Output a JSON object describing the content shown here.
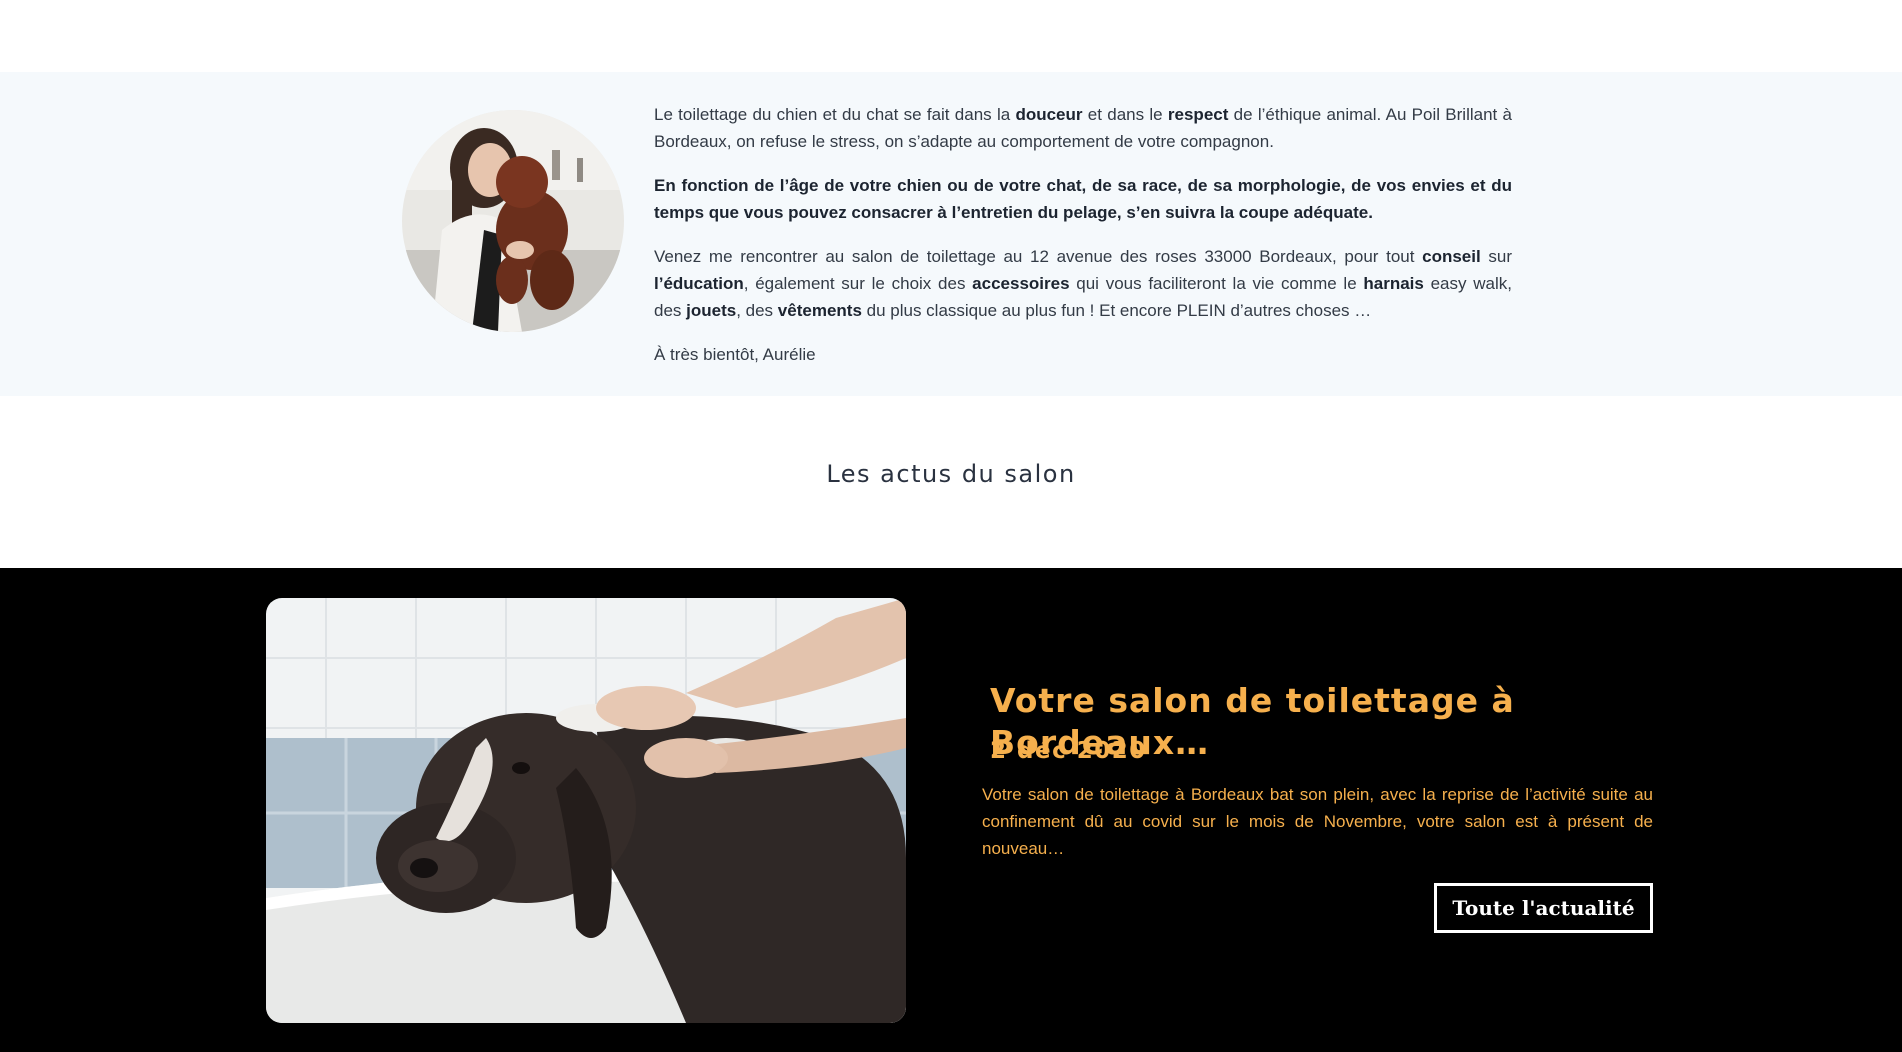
{
  "intro": {
    "avatar_alt": "Aurélie portrait with dog",
    "p1": {
      "t1": "Le toilettage du chien et du chat se fait dans la ",
      "b1": "douceur",
      "t2": " et dans le ",
      "b2": "respect",
      "t3": " de l’éthique animal. Au Poil Brillant à Bordeaux, on refuse le stress, on s’adapte au comportement de votre compagnon."
    },
    "p2": "En fonction de l’âge de votre chien ou de votre chat, de sa race, de sa morphologie, de vos envies et du temps que vous pouvez consacrer à l’entretien du pelage, s’en suivra  la coupe adéquate.",
    "p3": {
      "t1": "Venez me rencontrer au salon de toilettage au 12 avenue des roses 33000 Bordeaux, pour tout ",
      "b1": "conseil",
      "t2": " sur ",
      "b2": "l’éducation",
      "t3": ", également sur le choix des ",
      "b3": "accessoires",
      "t4": " qui vous faciliteront la vie comme le ",
      "b4": "harnais",
      "t5": " easy walk, des ",
      "b5": "jouets",
      "t6": ", des ",
      "b6": "vêtements",
      "t7": " du plus classique au plus fun ! Et encore PLEIN d’autres choses …"
    },
    "p4": "À très bientôt, Aurélie"
  },
  "section": {
    "title": "Les actus du salon"
  },
  "news": {
    "image_alt": "Dog being washed in a bathtub",
    "title": "Votre salon de toilettage à Bordeaux…",
    "date": "2 déc 2020",
    "excerpt": "Votre salon de toilettage à Bordeaux bat son plein, avec la reprise de l’activité suite au confinement dû au covid sur le mois de Novembre, votre salon est à présent de nouveau…",
    "button_label": "Toute l'actualité"
  },
  "colors": {
    "intro_bg": "#f5f9fc",
    "news_bg": "#000000",
    "accent": "#f6b04d",
    "text": "#333b46"
  }
}
